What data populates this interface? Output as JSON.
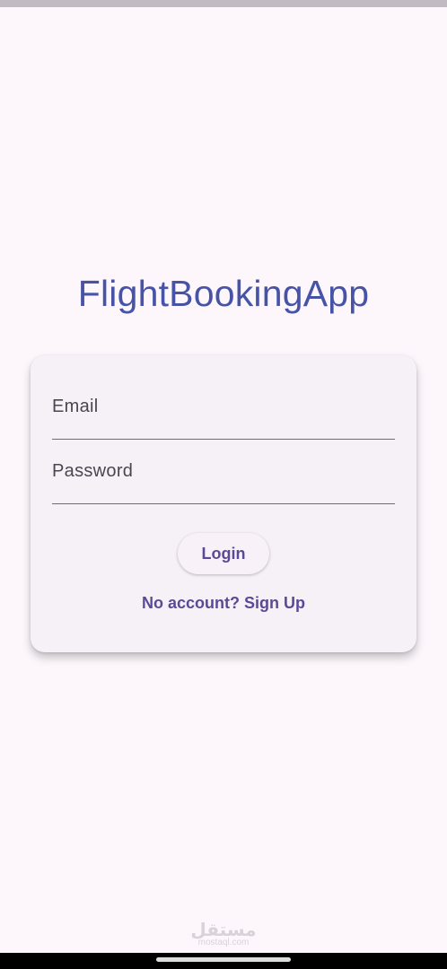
{
  "app": {
    "title": "FlightBookingApp"
  },
  "login_form": {
    "email_label": "Email",
    "password_label": "Password",
    "login_button_label": "Login",
    "signup_link_label": "No account? Sign Up"
  },
  "watermark": {
    "logo_text": "مستقل",
    "site_text": "mostaql.com"
  },
  "colors": {
    "background": "#fdf7fc",
    "title": "#4653a6",
    "card": "#f6f1f7",
    "accent": "#5a4a95",
    "status_bar": "#c2bac2",
    "nav_bar": "#000000"
  }
}
